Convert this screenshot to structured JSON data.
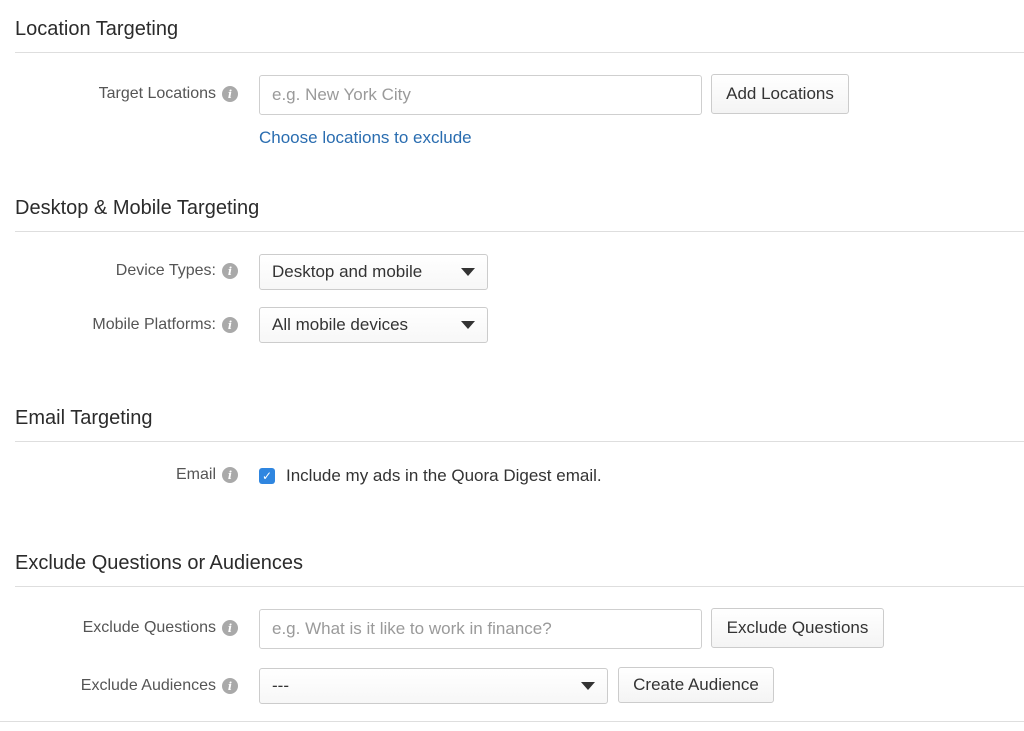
{
  "location": {
    "title": "Location Targeting",
    "target_label": "Target Locations",
    "target_placeholder": "e.g. New York City",
    "add_button": "Add Locations",
    "exclude_link": "Choose locations to exclude"
  },
  "device": {
    "title": "Desktop & Mobile Targeting",
    "device_types_label": "Device Types:",
    "device_types_value": "Desktop and mobile",
    "mobile_platforms_label": "Mobile Platforms:",
    "mobile_platforms_value": "All mobile devices"
  },
  "email": {
    "title": "Email Targeting",
    "label": "Email",
    "checkbox_checked": true,
    "checkbox_text": "Include my ads in the Quora Digest email."
  },
  "exclude": {
    "title": "Exclude Questions or Audiences",
    "questions_label": "Exclude Questions",
    "questions_placeholder": "e.g. What is it like to work in finance?",
    "questions_button": "Exclude Questions",
    "audiences_label": "Exclude Audiences",
    "audiences_value": "---",
    "create_audience_button": "Create Audience"
  },
  "icons": {
    "info": "info-icon",
    "caret": "chevron-down-icon",
    "check": "checkmark-icon"
  },
  "colors": {
    "link": "#2a6db0",
    "checkbox": "#2f86e0",
    "info_icon": "#a9a9a9"
  }
}
